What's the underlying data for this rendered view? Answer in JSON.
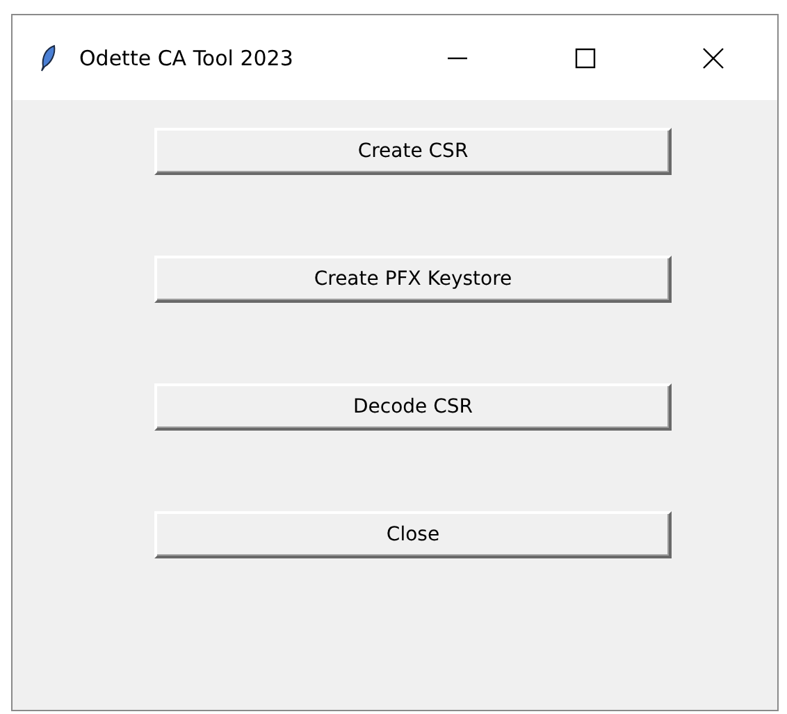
{
  "window": {
    "title": "Odette CA Tool 2023"
  },
  "buttons": [
    {
      "label": "Create CSR"
    },
    {
      "label": "Create PFX Keystore"
    },
    {
      "label": "Decode CSR"
    },
    {
      "label": "Close"
    }
  ]
}
